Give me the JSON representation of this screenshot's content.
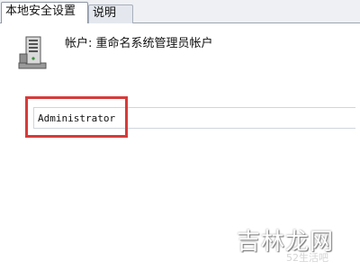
{
  "tabs": [
    {
      "label": "本地安全设置",
      "active": true
    },
    {
      "label": "说明",
      "active": false
    }
  ],
  "policy": {
    "label": "帐户: 重命名系统管理员帐户",
    "icon": "server-computer-icon"
  },
  "field": {
    "value": "Administrator"
  },
  "watermark": {
    "main": "吉林龙网",
    "sub": "52生活吧"
  },
  "colors": {
    "highlight": "#d73a3a"
  }
}
